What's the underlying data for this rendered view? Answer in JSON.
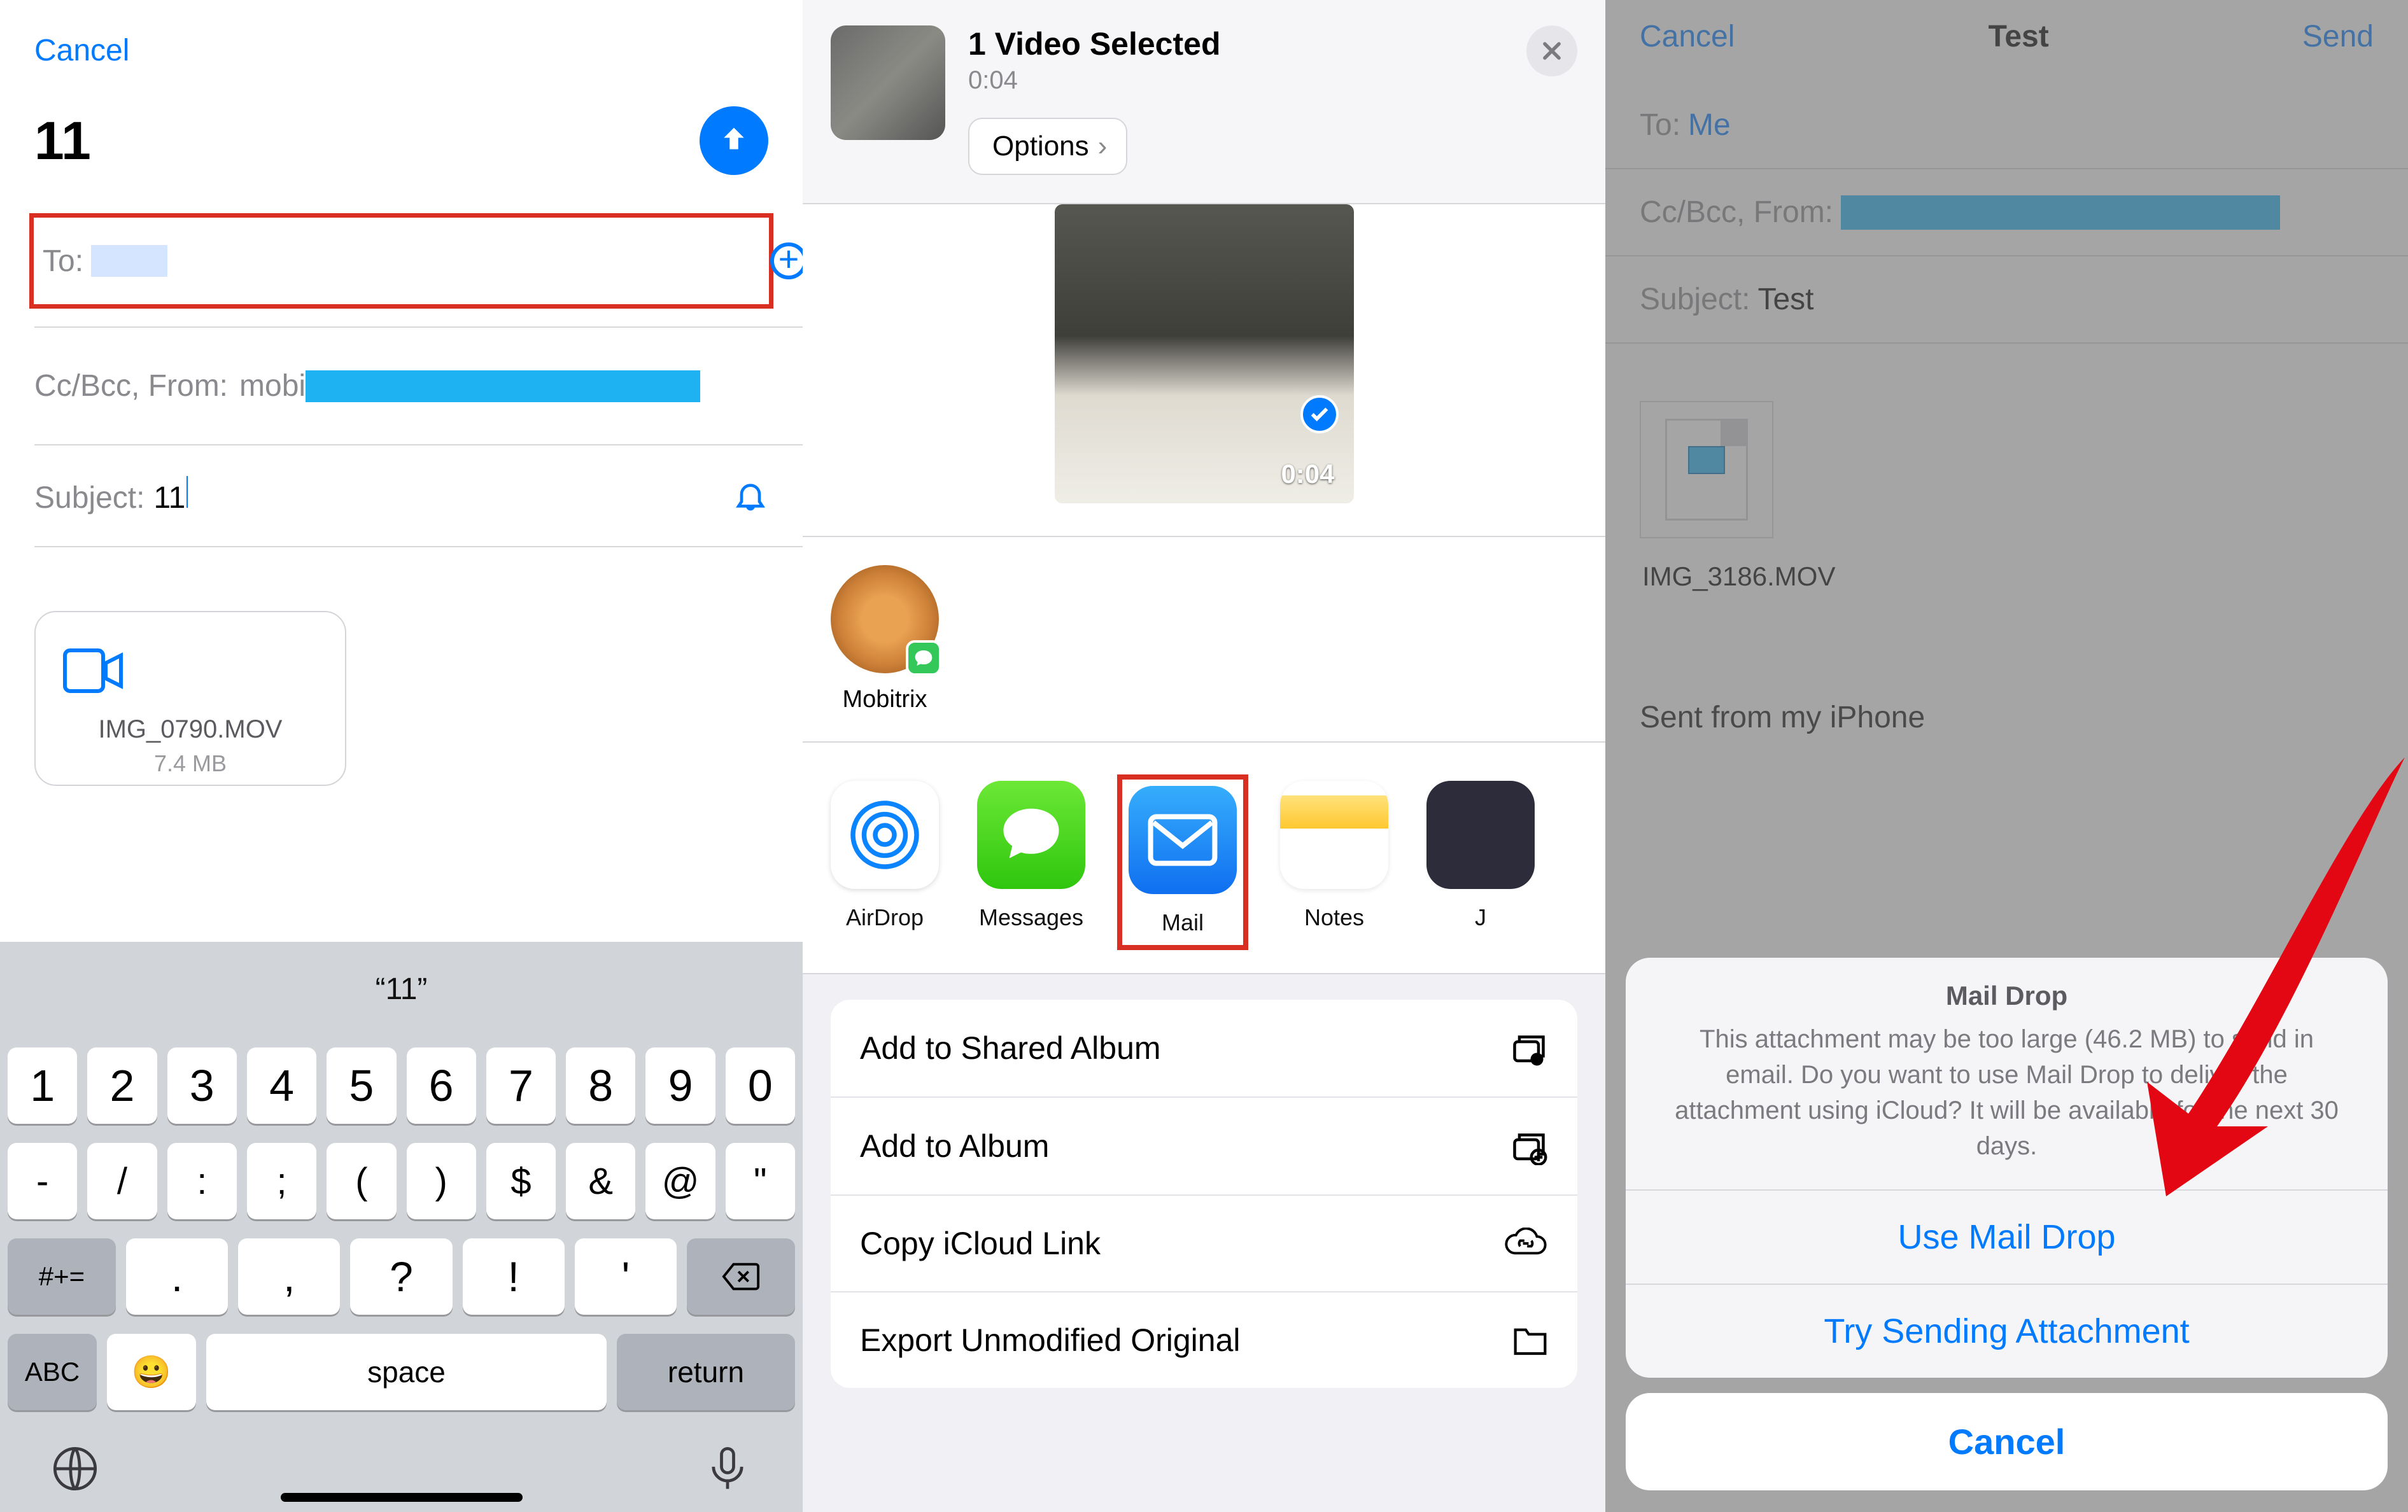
{
  "screen1": {
    "cancel": "Cancel",
    "title": "11",
    "to_label": "To:",
    "cc_label": "Cc/Bcc, From:",
    "cc_text": "mobi",
    "subject_label": "Subject:",
    "subject_value": "11",
    "attachment_name": "IMG_0790.MOV",
    "attachment_size": "7.4 MB",
    "keyboard": {
      "suggestion": "“11”",
      "numbers": [
        "1",
        "2",
        "3",
        "4",
        "5",
        "6",
        "7",
        "8",
        "9",
        "0"
      ],
      "row2": [
        "-",
        "/",
        ":",
        ";",
        "(",
        ")",
        "$",
        "&",
        "@",
        "\""
      ],
      "row3_left": "#+=",
      "row3_keys": [
        ".",
        ",",
        "?",
        "!",
        "'"
      ],
      "abc": "ABC",
      "space": "space",
      "return": "return"
    }
  },
  "screen2": {
    "header_title": "1 Video Selected",
    "header_duration": "0:04",
    "options": "Options",
    "video_duration": "0:04",
    "contact_name": "Mobitrix",
    "apps": {
      "airdrop": "AirDrop",
      "messages": "Messages",
      "mail": "Mail",
      "notes": "Notes",
      "extra": "J"
    },
    "actions": [
      "Add to Shared Album",
      "Add to Album",
      "Copy iCloud Link",
      "Export Unmodified Original"
    ]
  },
  "screen3": {
    "nav_cancel": "Cancel",
    "nav_title": "Test",
    "nav_send": "Send",
    "to_label": "To:",
    "to_value": "Me",
    "cc_label": "Cc/Bcc, From:",
    "subject_label": "Subject:",
    "subject_value": "Test",
    "file_name": "IMG_3186.MOV",
    "sent_from": "Sent from my iPhone",
    "dialog": {
      "title": "Mail Drop",
      "body": "This attachment may be too large (46.2 MB) to send in email. Do you want to use Mail Drop to deliver the attachment using iCloud? It will be available for the next 30 days.",
      "use_maildrop": "Use Mail Drop",
      "try_sending": "Try Sending Attachment",
      "cancel": "Cancel"
    }
  }
}
